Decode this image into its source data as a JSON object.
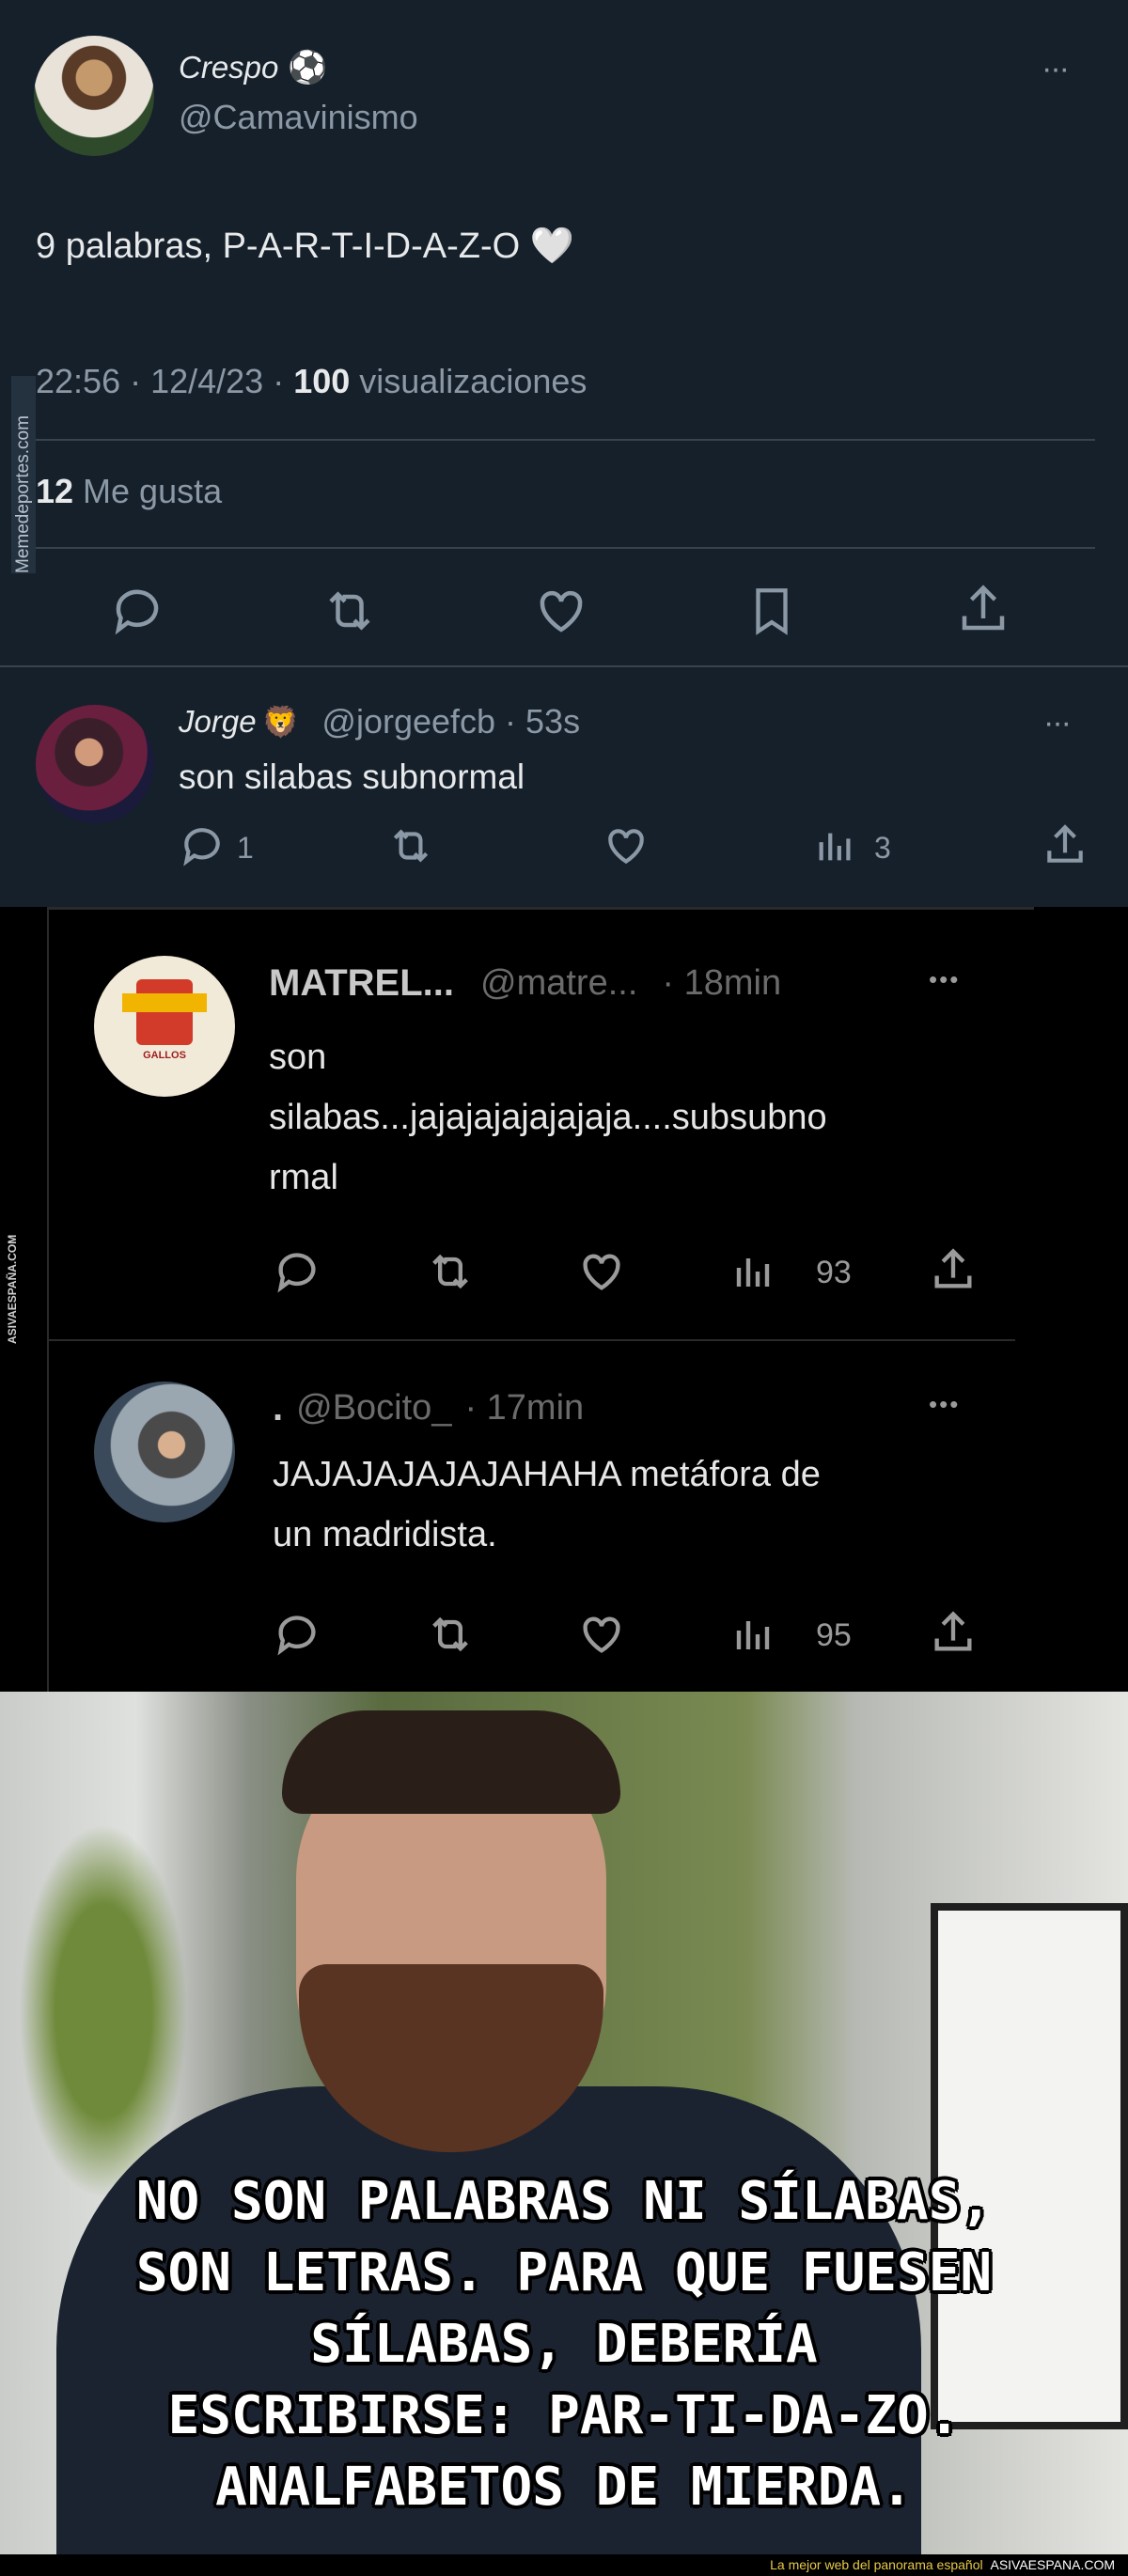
{
  "tweet": {
    "display_name": "Crespo",
    "display_name_emoji": "⚽",
    "handle": "@Camavinismo",
    "text": "9 palabras, P-A-R-T-I-D-A-Z-O 🤍",
    "time": "22:56 · 12/4/23 · ",
    "views_count": "100",
    "views_label": " visualizaciones",
    "likes_count": "12",
    "likes_label": " Me gusta",
    "more": "···"
  },
  "watermark_left": "Memedeportes.com",
  "reply1": {
    "display_name": "Jorge",
    "emoji": "🦁",
    "handle": "@jorgeefcb · 53s",
    "text": "son silabas subnormal",
    "reply_count": "1",
    "views_count": "3",
    "more": "···"
  },
  "reply2": {
    "display_name": "MATREL...",
    "handle": "@matre...",
    "time": "· 18min",
    "text_lines": [
      "son",
      "silabas...jajajajajajajaja....subsubno",
      "rmal"
    ],
    "views_count": "93",
    "avatar_label": "GALLOS",
    "more": "•••"
  },
  "reply3": {
    "display_name": ".",
    "handle": "@Bocito_",
    "time": "· 17min",
    "text_lines": [
      "JAJAJAJAJAJAHAHA metáfora de",
      "un madridista."
    ],
    "views_count": "95",
    "more": "•••"
  },
  "watermark_asiv": "ASIVAESPAÑA.COM",
  "meme": {
    "lines": [
      "NO SON PALABRAS NI SÍLABAS,",
      "SON LETRAS. PARA QUE FUESEN",
      "SÍLABAS, DEBERÍA",
      "ESCRIBIRSE: PAR-TI-DA-ZO.",
      "ANALFABETOS DE MIERDA."
    ]
  },
  "footer": {
    "tagline": "La mejor web del panorama español",
    "brand": "ASIVAESPANA.COM"
  },
  "colors": {
    "tweet_bg": "#15202b",
    "text": "#e7e9ea",
    "secondary": "#8b98a5",
    "divider": "#38444d"
  }
}
